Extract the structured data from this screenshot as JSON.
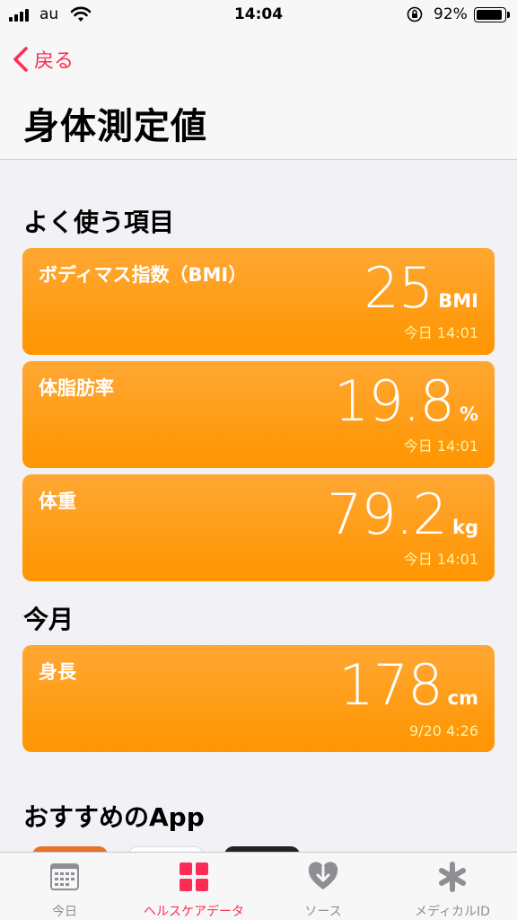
{
  "status_bar": {
    "carrier": "au",
    "time": "14:04",
    "battery": "92%"
  },
  "nav": {
    "back_label": "戻る",
    "title": "身体測定値"
  },
  "sections": {
    "frequent": "よく使う項目",
    "this_month": "今月",
    "recommended": "おすすめのApp"
  },
  "cards": [
    {
      "label": "ボディマス指数（BMI）",
      "value": "25",
      "unit": "BMI",
      "time": "今日 14:01"
    },
    {
      "label": "体脂肪率",
      "value": "19.8",
      "unit": "%",
      "time": "今日 14:01"
    },
    {
      "label": "体重",
      "value": "79.2",
      "unit": "kg",
      "time": "今日 14:01"
    },
    {
      "label": "身長",
      "value": "178",
      "unit": "cm",
      "time": "9/20 4:26"
    }
  ],
  "tabs": [
    {
      "label": "今日",
      "icon": "calendar-icon"
    },
    {
      "label": "ヘルスケアデータ",
      "icon": "grid-icon"
    },
    {
      "label": "ソース",
      "icon": "heart-download-icon"
    },
    {
      "label": "メディカルID",
      "icon": "asterisk-icon"
    }
  ],
  "colors": {
    "accent": "#ff2d55",
    "card": "#ff9500",
    "card_time": "#fff2a8"
  }
}
